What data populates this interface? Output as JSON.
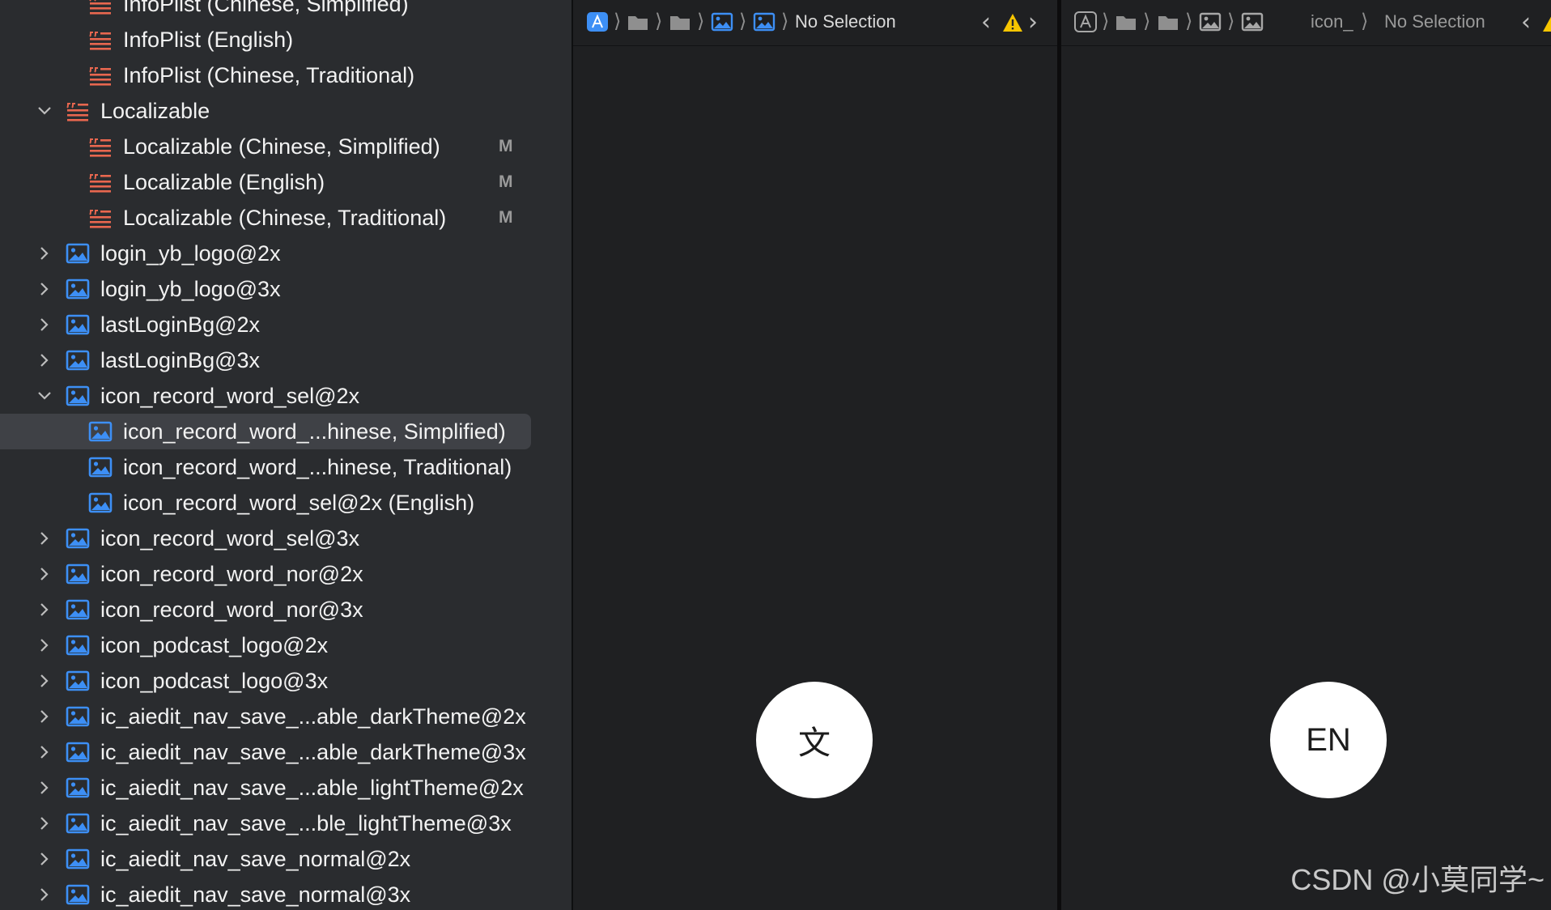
{
  "navigator": {
    "rows": [
      {
        "label": "InfoPlist (Chinese, Simplified)",
        "icon": "strings-file-icon",
        "disclosure": "",
        "badge": ""
      },
      {
        "label": "InfoPlist (English)",
        "icon": "strings-file-icon",
        "disclosure": "",
        "badge": ""
      },
      {
        "label": "InfoPlist (Chinese, Traditional)",
        "icon": "strings-file-icon",
        "disclosure": "",
        "badge": ""
      },
      {
        "label": "Localizable",
        "icon": "strings-file-icon",
        "disclosure": "expanded",
        "badge": ""
      },
      {
        "label": "Localizable (Chinese, Simplified)",
        "icon": "strings-file-icon",
        "disclosure": "",
        "badge": "M"
      },
      {
        "label": "Localizable (English)",
        "icon": "strings-file-icon",
        "disclosure": "",
        "badge": "M"
      },
      {
        "label": "Localizable (Chinese, Traditional)",
        "icon": "strings-file-icon",
        "disclosure": "",
        "badge": "M"
      },
      {
        "label": "login_yb_logo@2x",
        "icon": "image-file-icon",
        "disclosure": "collapsed",
        "badge": ""
      },
      {
        "label": "login_yb_logo@3x",
        "icon": "image-file-icon",
        "disclosure": "collapsed",
        "badge": ""
      },
      {
        "label": "lastLoginBg@2x",
        "icon": "image-file-icon",
        "disclosure": "collapsed",
        "badge": ""
      },
      {
        "label": "lastLoginBg@3x",
        "icon": "image-file-icon",
        "disclosure": "collapsed",
        "badge": ""
      },
      {
        "label": "icon_record_word_sel@2x",
        "icon": "image-file-icon",
        "disclosure": "expanded",
        "badge": ""
      },
      {
        "label": "icon_record_word_...hinese, Simplified)",
        "icon": "image-file-icon",
        "disclosure": "",
        "badge": "",
        "selected": true
      },
      {
        "label": "icon_record_word_...hinese, Traditional)",
        "icon": "image-file-icon",
        "disclosure": "",
        "badge": ""
      },
      {
        "label": "icon_record_word_sel@2x (English)",
        "icon": "image-file-icon",
        "disclosure": "",
        "badge": ""
      },
      {
        "label": "icon_record_word_sel@3x",
        "icon": "image-file-icon",
        "disclosure": "collapsed",
        "badge": ""
      },
      {
        "label": "icon_record_word_nor@2x",
        "icon": "image-file-icon",
        "disclosure": "collapsed",
        "badge": ""
      },
      {
        "label": "icon_record_word_nor@3x",
        "icon": "image-file-icon",
        "disclosure": "collapsed",
        "badge": ""
      },
      {
        "label": "icon_podcast_logo@2x",
        "icon": "image-file-icon",
        "disclosure": "collapsed",
        "badge": ""
      },
      {
        "label": "icon_podcast_logo@3x",
        "icon": "image-file-icon",
        "disclosure": "collapsed",
        "badge": ""
      },
      {
        "label": "ic_aiedit_nav_save_...able_darkTheme@2x",
        "icon": "image-file-icon",
        "disclosure": "collapsed",
        "badge": ""
      },
      {
        "label": "ic_aiedit_nav_save_...able_darkTheme@3x",
        "icon": "image-file-icon",
        "disclosure": "collapsed",
        "badge": ""
      },
      {
        "label": "ic_aiedit_nav_save_...able_lightTheme@2x",
        "icon": "image-file-icon",
        "disclosure": "collapsed",
        "badge": ""
      },
      {
        "label": "ic_aiedit_nav_save_...ble_lightTheme@3x",
        "icon": "image-file-icon",
        "disclosure": "collapsed",
        "badge": ""
      },
      {
        "label": "ic_aiedit_nav_save_normal@2x",
        "icon": "image-file-icon",
        "disclosure": "collapsed",
        "badge": ""
      },
      {
        "label": "ic_aiedit_nav_save_normal@3x",
        "icon": "image-file-icon",
        "disclosure": "collapsed",
        "badge": ""
      }
    ]
  },
  "editor_left": {
    "no_selection": "No Selection",
    "language_button": "文"
  },
  "editor_right": {
    "crumb_text": "icon_",
    "no_selection": "No Selection",
    "language_button": "EN"
  },
  "watermark": "CSDN @小莫同学~",
  "colors": {
    "strings_icon": "#e8674f",
    "image_icon_active": "#3d8ff5",
    "image_icon_inactive": "#a7a7a7",
    "warning": "#f7c500",
    "selected_row": "#3f4146"
  }
}
